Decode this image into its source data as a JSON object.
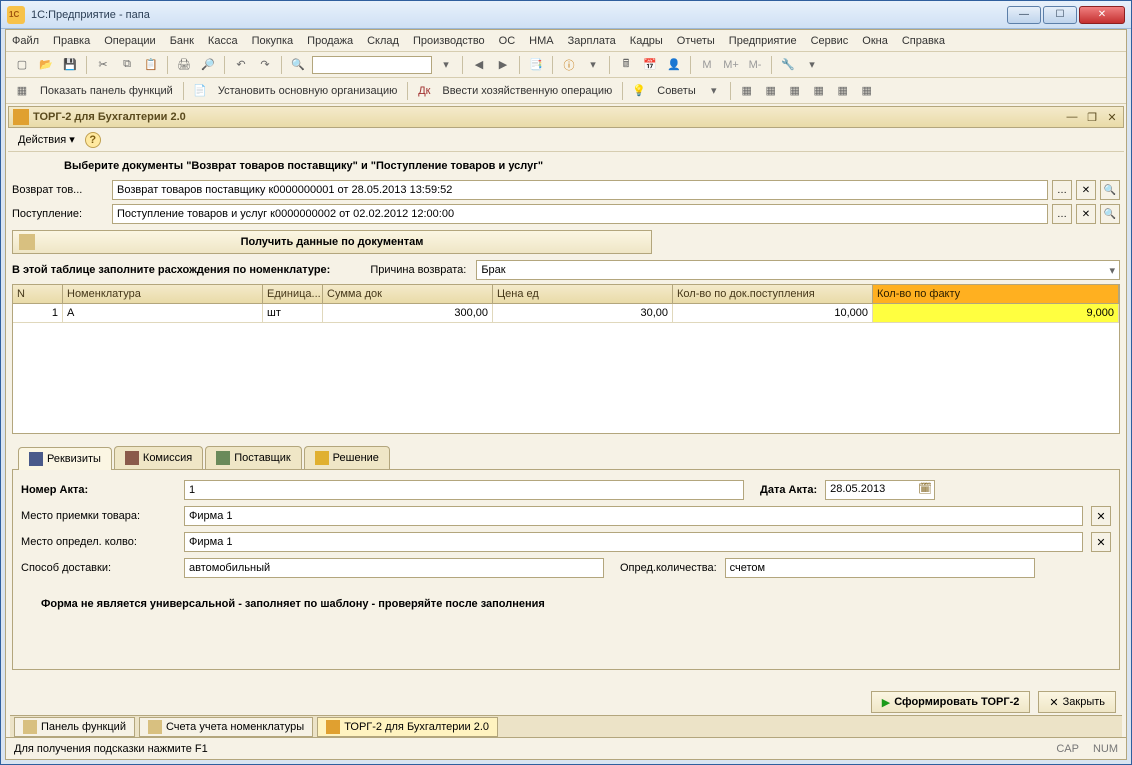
{
  "window_title": "1С:Предприятие - папа",
  "menu": [
    "Файл",
    "Правка",
    "Операции",
    "Банк",
    "Касса",
    "Покупка",
    "Продажа",
    "Склад",
    "Производство",
    "ОС",
    "НМА",
    "Зарплата",
    "Кадры",
    "Отчеты",
    "Предприятие",
    "Сервис",
    "Окна",
    "Справка"
  ],
  "toolbar2": {
    "show_panel": "Показать панель функций",
    "set_org": "Установить основную организацию",
    "enter_op": "Ввести хозяйственную операцию",
    "advice": "Советы"
  },
  "sub_title": "ТОРГ-2  для Бухгалтерии 2.0",
  "actions_label": "Действия",
  "prompt": "Выберите документы \"Возврат товаров поставщику\" и \"Поступление товаров и услуг\"",
  "field_return_lbl": "Возврат тов...",
  "field_return_val": "Возврат товаров поставщику к0000000001 от 28.05.2013 13:59:52",
  "field_post_lbl": "Поступление:",
  "field_post_val": "Поступление товаров и услуг к0000000002 от 02.02.2012 12:00:00",
  "big_btn": "Получить данные по документам",
  "fill_line": "В этой таблице заполните расхождения по номенклатуре:",
  "reason_lbl": "Причина возврата:",
  "reason_val": "Брак",
  "table": {
    "headers": [
      "N",
      "Номенклатура",
      "Единица...",
      "Сумма док",
      "Цена ед",
      "Кол-во по док.поступления",
      "Кол-во по факту"
    ],
    "rows": [
      {
        "n": "1",
        "nomen": "А",
        "unit": "шт",
        "sum": "300,00",
        "price": "30,00",
        "qty": "10,000",
        "fact": "9,000"
      }
    ]
  },
  "tabs": [
    "Реквизиты",
    "Комиссия",
    "Поставщик",
    "Решение"
  ],
  "req": {
    "act_no_lbl": "Номер Акта:",
    "act_no_val": "1",
    "act_date_lbl": "Дата Акта:",
    "act_date_val": "28.05.2013",
    "place1_lbl": "Место приемки товара:",
    "place1_val": "Фирма 1",
    "place2_lbl": "Место определ. колво:",
    "place2_val": "Фирма 1",
    "delivery_lbl": "Способ доставки:",
    "delivery_val": "автомобильный",
    "qty_det_lbl": "Опред.количества:",
    "qty_det_val": "счетом"
  },
  "note": "Форма не является универсальной - заполняет по шаблону - проверяйте после заполнения",
  "footer": {
    "form": "Сформировать ТОРГ-2",
    "close": "Закрыть"
  },
  "wintabs": [
    "Панель функций",
    "Счета учета номенклатуры",
    "ТОРГ-2  для Бухгалтерии 2.0"
  ],
  "status": "Для получения подсказки нажмите F1",
  "indicators": {
    "cap": "CAP",
    "num": "NUM"
  }
}
